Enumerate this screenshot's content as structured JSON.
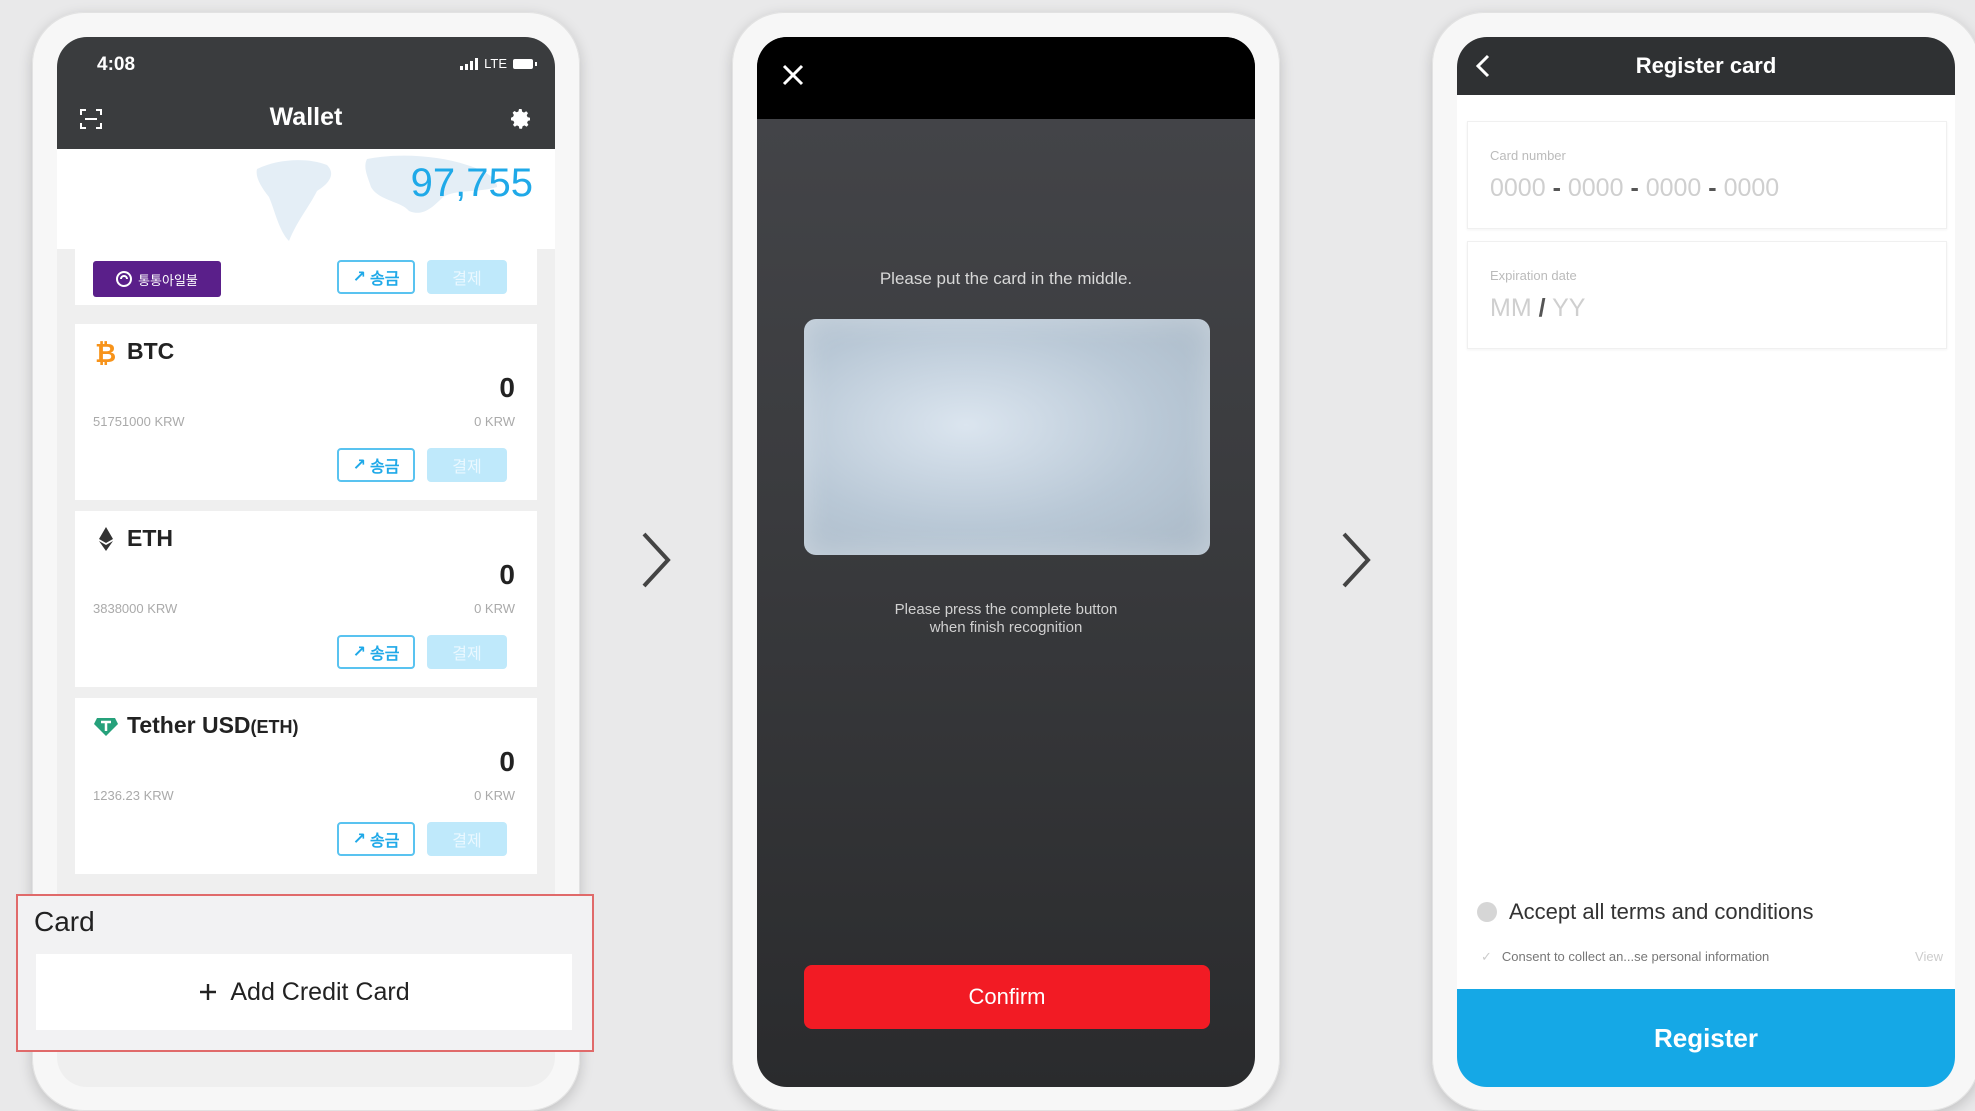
{
  "phone1": {
    "status": {
      "time": "4:08",
      "network": "LTE"
    },
    "header": {
      "title": "Wallet"
    },
    "balance": "97,755",
    "mobile_money": {
      "label": "통통아일불"
    },
    "send_label": "송금",
    "pay_label": "결제",
    "coins": [
      {
        "name": "BTC",
        "suffix": "",
        "amount": "0",
        "price": "51751000 KRW",
        "krw": "0 KRW",
        "color": "#f7931a"
      },
      {
        "name": "ETH",
        "suffix": "",
        "amount": "0",
        "price": "3838000 KRW",
        "krw": "0 KRW",
        "color": "#333333"
      },
      {
        "name": "Tether USD",
        "suffix": "(ETH)",
        "amount": "0",
        "price": "1236.23 KRW",
        "krw": "0 KRW",
        "color": "#26a17b"
      }
    ],
    "card_section": {
      "label": "Card",
      "add_label": "Add Credit Card"
    }
  },
  "phone2": {
    "hint_top": "Please put the card in the middle.",
    "hint_bottom": "Please press the complete button\nwhen finish recognition",
    "confirm_label": "Confirm"
  },
  "phone3": {
    "header": {
      "title": "Register card"
    },
    "card_number": {
      "label": "Card number",
      "parts": [
        "0000",
        "0000",
        "0000",
        "0000"
      ],
      "sep": "-"
    },
    "expiration": {
      "label": "Expiration date",
      "month": "MM",
      "sep": "/",
      "year": "YY"
    },
    "terms": {
      "label": "Accept all terms and conditions",
      "consent": "Consent to collect an...se personal information",
      "view": "View"
    },
    "register_label": "Register"
  },
  "colors": {
    "accent": "#1fa9e8",
    "confirm": "#f21b24",
    "register": "#15a8e6",
    "highlight": "#e06a6a"
  }
}
